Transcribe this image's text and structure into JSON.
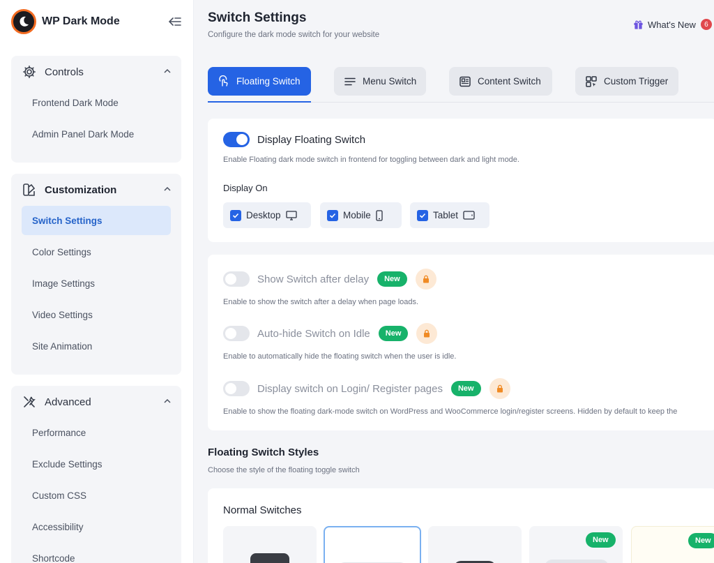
{
  "sidebar": {
    "brand": "WP Dark Mode",
    "groups": [
      {
        "label": "Controls",
        "items": [
          "Frontend Dark Mode",
          "Admin Panel Dark Mode"
        ]
      },
      {
        "label": "Customization",
        "items": [
          "Switch Settings",
          "Color Settings",
          "Image Settings",
          "Video Settings",
          "Site Animation"
        ]
      },
      {
        "label": "Advanced",
        "items": [
          "Performance",
          "Exclude Settings",
          "Custom CSS",
          "Accessibility",
          "Shortcode"
        ]
      }
    ]
  },
  "header": {
    "title": "Switch Settings",
    "subtitle": "Configure the dark mode switch for your website",
    "whats_new": "What's New",
    "whats_new_count": "6"
  },
  "tabs": [
    "Floating Switch",
    "Menu Switch",
    "Content Switch",
    "Custom Trigger"
  ],
  "floating": {
    "title": "Display Floating Switch",
    "desc": "Enable Floating dark mode switch in frontend for toggling between dark and light mode.",
    "display_on_label": "Display On",
    "devices": [
      "Desktop",
      "Mobile",
      "Tablet"
    ]
  },
  "options": [
    {
      "title": "Show Switch after delay",
      "badge": "New",
      "desc": "Enable to show the switch after a delay when page loads."
    },
    {
      "title": "Auto-hide Switch on Idle",
      "badge": "New",
      "desc": "Enable to automatically hide the floating switch when the user is idle."
    },
    {
      "title": "Display switch on Login/ Register pages",
      "badge": "New",
      "desc": "Enable to show the floating dark-mode switch on WordPress and WooCommerce login/register screens. Hidden by default to keep the"
    }
  ],
  "styles": {
    "title": "Floating Switch Styles",
    "subtitle": "Choose the style of the floating toggle switch",
    "normal_title": "Normal Switches",
    "new_badge": "New"
  },
  "colors": {
    "accent": "#2563e4",
    "new_badge": "#17b26a",
    "brand_ring": "#f26b21"
  }
}
